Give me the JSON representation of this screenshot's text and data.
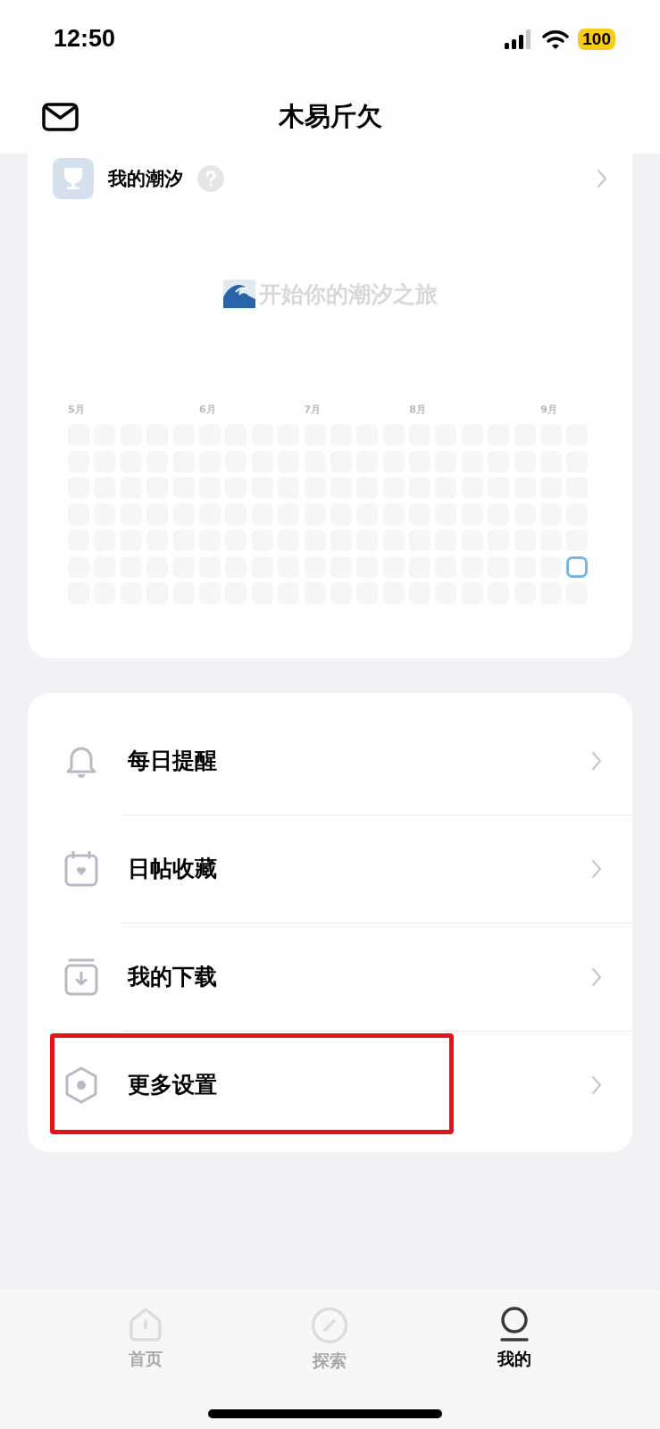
{
  "status_bar": {
    "time": "12:50",
    "battery": "100"
  },
  "header": {
    "title": "木易斤欠"
  },
  "tide_card": {
    "title": "我的潮汐",
    "empty_message": "开始你的潮汐之旅",
    "weeks": [
      {
        "month": "5月",
        "days": [
          {
            "today": false
          },
          {
            "today": false
          },
          {
            "today": false
          },
          {
            "today": false
          },
          {
            "today": false
          },
          {
            "today": false
          },
          {
            "today": false
          }
        ]
      },
      {
        "days": [
          {
            "today": false
          },
          {
            "today": false
          },
          {
            "today": false
          },
          {
            "today": false
          },
          {
            "today": false
          },
          {
            "today": false
          },
          {
            "today": false
          }
        ]
      },
      {
        "days": [
          {
            "today": false
          },
          {
            "today": false
          },
          {
            "today": false
          },
          {
            "today": false
          },
          {
            "today": false
          },
          {
            "today": false
          },
          {
            "today": false
          }
        ]
      },
      {
        "days": [
          {
            "today": false
          },
          {
            "today": false
          },
          {
            "today": false
          },
          {
            "today": false
          },
          {
            "today": false
          },
          {
            "today": false
          },
          {
            "today": false
          }
        ]
      },
      {
        "days": [
          {
            "today": false
          },
          {
            "today": false
          },
          {
            "today": false
          },
          {
            "today": false
          },
          {
            "today": false
          },
          {
            "today": false
          },
          {
            "today": false
          }
        ]
      },
      {
        "month": "6月",
        "days": [
          {
            "today": false
          },
          {
            "today": false
          },
          {
            "today": false
          },
          {
            "today": false
          },
          {
            "today": false
          },
          {
            "today": false
          },
          {
            "today": false
          }
        ]
      },
      {
        "days": [
          {
            "today": false
          },
          {
            "today": false
          },
          {
            "today": false
          },
          {
            "today": false
          },
          {
            "today": false
          },
          {
            "today": false
          },
          {
            "today": false
          }
        ]
      },
      {
        "days": [
          {
            "today": false
          },
          {
            "today": false
          },
          {
            "today": false
          },
          {
            "today": false
          },
          {
            "today": false
          },
          {
            "today": false
          },
          {
            "today": false
          }
        ]
      },
      {
        "days": [
          {
            "today": false
          },
          {
            "today": false
          },
          {
            "today": false
          },
          {
            "today": false
          },
          {
            "today": false
          },
          {
            "today": false
          },
          {
            "today": false
          }
        ]
      },
      {
        "month": "7月",
        "days": [
          {
            "today": false
          },
          {
            "today": false
          },
          {
            "today": false
          },
          {
            "today": false
          },
          {
            "today": false
          },
          {
            "today": false
          },
          {
            "today": false
          }
        ]
      },
      {
        "days": [
          {
            "today": false
          },
          {
            "today": false
          },
          {
            "today": false
          },
          {
            "today": false
          },
          {
            "today": false
          },
          {
            "today": false
          },
          {
            "today": false
          }
        ]
      },
      {
        "days": [
          {
            "today": false
          },
          {
            "today": false
          },
          {
            "today": false
          },
          {
            "today": false
          },
          {
            "today": false
          },
          {
            "today": false
          },
          {
            "today": false
          }
        ]
      },
      {
        "days": [
          {
            "today": false
          },
          {
            "today": false
          },
          {
            "today": false
          },
          {
            "today": false
          },
          {
            "today": false
          },
          {
            "today": false
          },
          {
            "today": false
          }
        ]
      },
      {
        "month": "8月",
        "days": [
          {
            "today": false
          },
          {
            "today": false
          },
          {
            "today": false
          },
          {
            "today": false
          },
          {
            "today": false
          },
          {
            "today": false
          },
          {
            "today": false
          }
        ]
      },
      {
        "days": [
          {
            "today": false
          },
          {
            "today": false
          },
          {
            "today": false
          },
          {
            "today": false
          },
          {
            "today": false
          },
          {
            "today": false
          },
          {
            "today": false
          }
        ]
      },
      {
        "days": [
          {
            "today": false
          },
          {
            "today": false
          },
          {
            "today": false
          },
          {
            "today": false
          },
          {
            "today": false
          },
          {
            "today": false
          },
          {
            "today": false
          }
        ]
      },
      {
        "days": [
          {
            "today": false
          },
          {
            "today": false
          },
          {
            "today": false
          },
          {
            "today": false
          },
          {
            "today": false
          },
          {
            "today": false
          },
          {
            "today": false
          }
        ]
      },
      {
        "days": [
          {
            "today": false
          },
          {
            "today": false
          },
          {
            "today": false
          },
          {
            "today": false
          },
          {
            "today": false
          },
          {
            "today": false
          },
          {
            "today": false
          }
        ]
      },
      {
        "month": "9月",
        "days": [
          {
            "today": false
          },
          {
            "today": false
          },
          {
            "today": false
          },
          {
            "today": false
          },
          {
            "today": false
          },
          {
            "today": false
          },
          {
            "today": false
          }
        ]
      },
      {
        "days": [
          {
            "today": false
          },
          {
            "today": false
          },
          {
            "today": false
          },
          {
            "today": false
          },
          {
            "today": false
          },
          {
            "today": true
          },
          {
            "today": false
          }
        ]
      }
    ]
  },
  "menu": [
    {
      "kind": "bell",
      "label": "每日提醒",
      "highlighted": false
    },
    {
      "kind": "calendar",
      "label": "日帖收藏",
      "highlighted": false
    },
    {
      "kind": "download",
      "label": "我的下载",
      "highlighted": false
    },
    {
      "kind": "settings",
      "label": "更多设置",
      "highlighted": true
    }
  ],
  "tabs": [
    {
      "kind": "home",
      "label": "首页",
      "selected": false
    },
    {
      "kind": "explore",
      "label": "探索",
      "selected": false
    },
    {
      "kind": "profile",
      "label": "我的",
      "selected": true
    }
  ]
}
